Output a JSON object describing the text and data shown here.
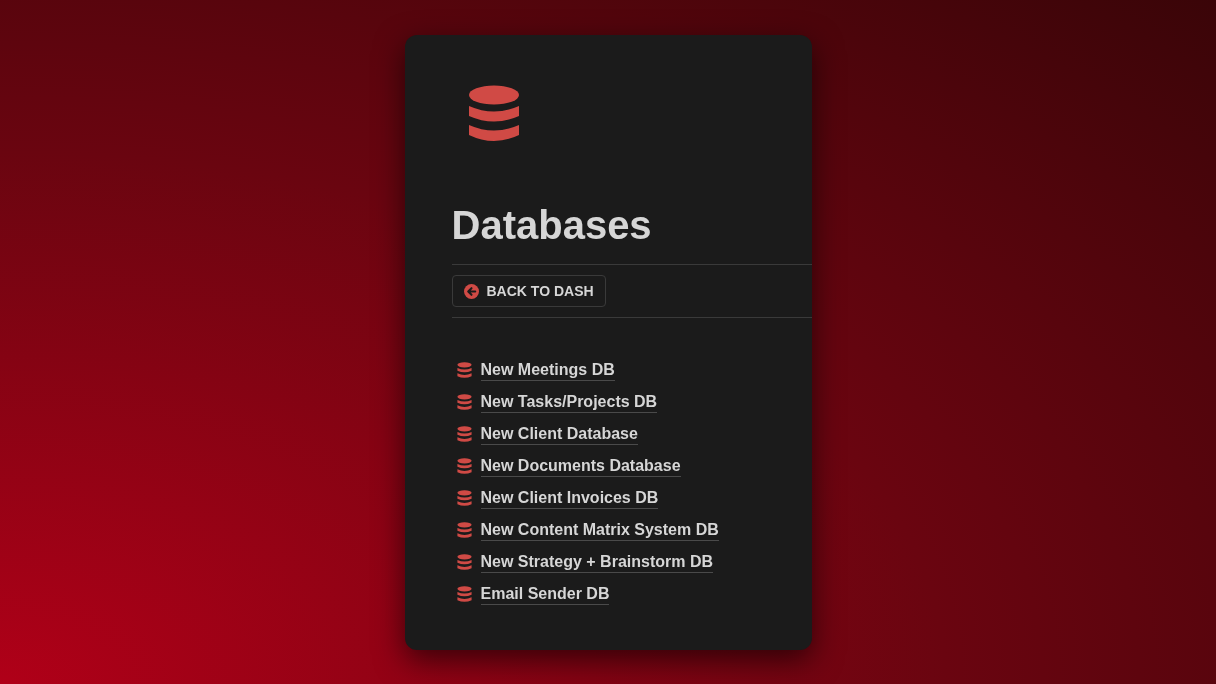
{
  "page": {
    "title": "Databases"
  },
  "back_button": {
    "label": "BACK TO DASH"
  },
  "links": [
    {
      "label": "New Meetings DB"
    },
    {
      "label": "New Tasks/Projects DB"
    },
    {
      "label": "New Client Database"
    },
    {
      "label": "New Documents Database"
    },
    {
      "label": "New Client Invoices DB"
    },
    {
      "label": "New Content Matrix System DB"
    },
    {
      "label": "New Strategy + Brainstorm DB"
    },
    {
      "label": "Email Sender DB"
    }
  ]
}
